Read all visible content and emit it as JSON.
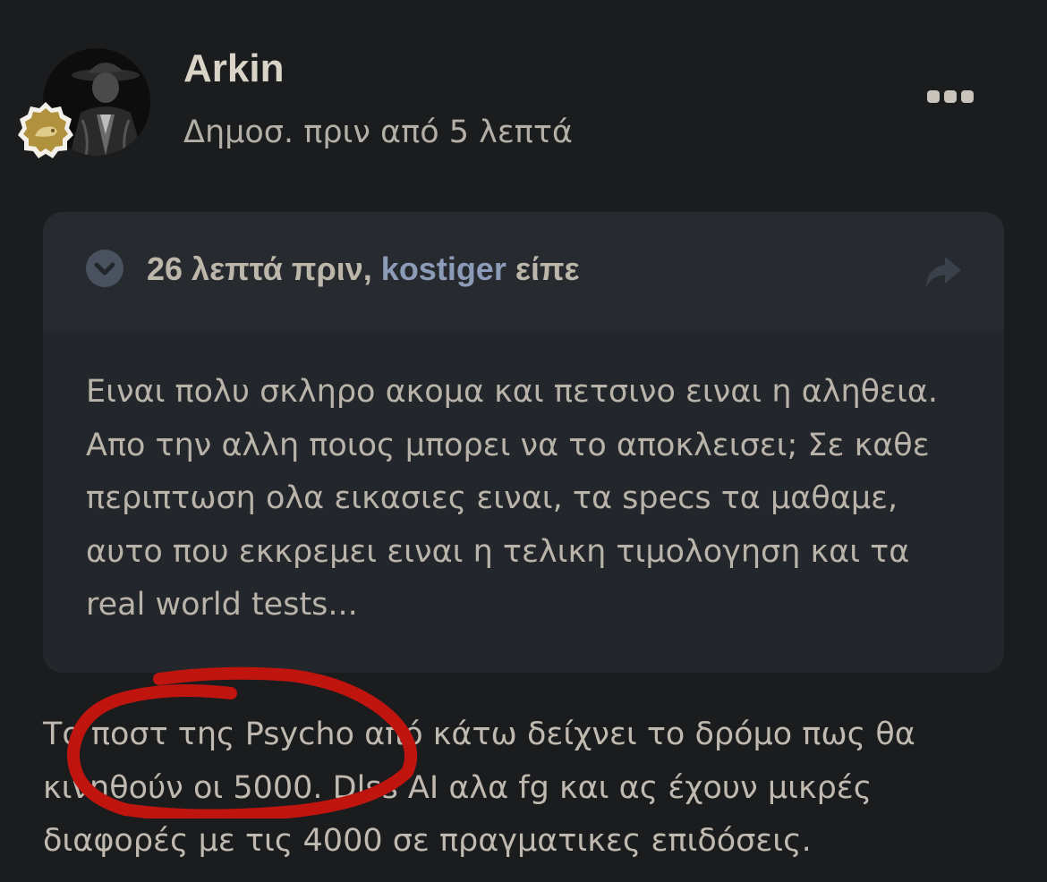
{
  "post": {
    "author": "Arkin",
    "meta": "Δημοσ. πριν από 5 λεπτά",
    "menu_icon": "ellipsis-icon"
  },
  "quote": {
    "time": "26 λεπτά πριν,",
    "user": "kostiger",
    "said": "είπε",
    "lines": [
      "Ειναι πολυ σκληρο ακομα και πετσινο ειναι η αληθεια.",
      "Απο την αλλη ποιος μπορει να το αποκλεισει; Σε καθε",
      "περιπτωση ολα εικασιες ειναι, τα specs τα μαθαμε,",
      "αυτο που εκκρεμει ειναι η τελικη τιμολογηση και τα",
      "real world tests..."
    ]
  },
  "body": {
    "lines": [
      "Το ποστ της Psycho από κάτω δείχνει το δρόμο πως θα",
      "κινηθούν οι 5000. Dlss AI αλα fg και ας έχουν μικρές",
      "διαφορές με τις 4000 σε πραγματικες επιδόσεις."
    ]
  },
  "colors": {
    "background": "#1b1c1e",
    "quote_background": "#23262a",
    "link": "#8c9bb8",
    "annotation": "#c0150f",
    "badge": "#b0923e"
  }
}
